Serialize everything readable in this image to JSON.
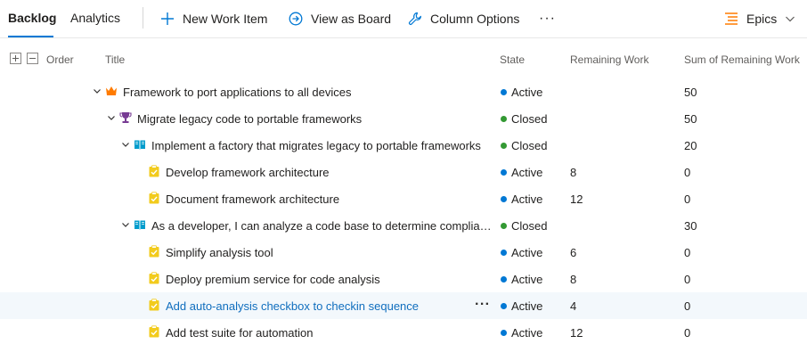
{
  "tabs": {
    "backlog": "Backlog",
    "analytics": "Analytics"
  },
  "toolbar": {
    "new_work_item": "New Work Item",
    "view_as_board": "View as Board",
    "column_options": "Column Options",
    "more": "···",
    "level": "Epics"
  },
  "columns": {
    "order": "Order",
    "title": "Title",
    "state": "State",
    "remaining_work": "Remaining Work",
    "sum_remaining_work": "Sum of Remaining Work"
  },
  "colors": {
    "accent": "#0078d4",
    "active": "#0078d4",
    "closed": "#339933",
    "epic": "#ff7b00",
    "feature": "#773b93",
    "story": "#009ccc",
    "task": "#f2cb1d"
  },
  "rows": [
    {
      "level": 0,
      "type": "epic",
      "expanded": true,
      "title": "Framework to port applications to all devices",
      "state": "Active",
      "remaining": "",
      "sum": "50"
    },
    {
      "level": 1,
      "type": "feature",
      "expanded": true,
      "title": "Migrate legacy code to portable frameworks",
      "state": "Closed",
      "remaining": "",
      "sum": "50"
    },
    {
      "level": 2,
      "type": "story",
      "expanded": true,
      "title": "Implement a factory that migrates legacy to portable frameworks",
      "state": "Closed",
      "remaining": "",
      "sum": "20"
    },
    {
      "level": 3,
      "type": "task",
      "title": "Develop framework architecture",
      "state": "Active",
      "remaining": "8",
      "sum": "0"
    },
    {
      "level": 3,
      "type": "task",
      "title": "Document framework architecture",
      "state": "Active",
      "remaining": "12",
      "sum": "0"
    },
    {
      "level": 2,
      "type": "story",
      "expanded": true,
      "title": "As a developer, I can analyze a code base to determine complian...",
      "state": "Closed",
      "remaining": "",
      "sum": "30"
    },
    {
      "level": 3,
      "type": "task",
      "title": "Simplify analysis tool",
      "state": "Active",
      "remaining": "6",
      "sum": "0"
    },
    {
      "level": 3,
      "type": "task",
      "title": "Deploy premium service for code analysis",
      "state": "Active",
      "remaining": "8",
      "sum": "0"
    },
    {
      "level": 3,
      "type": "task",
      "title": "Add auto-analysis checkbox to checkin sequence",
      "state": "Active",
      "remaining": "4",
      "sum": "0",
      "selected": true,
      "more": "···"
    },
    {
      "level": 3,
      "type": "task",
      "title": "Add test suite for automation",
      "state": "Active",
      "remaining": "12",
      "sum": "0"
    }
  ]
}
